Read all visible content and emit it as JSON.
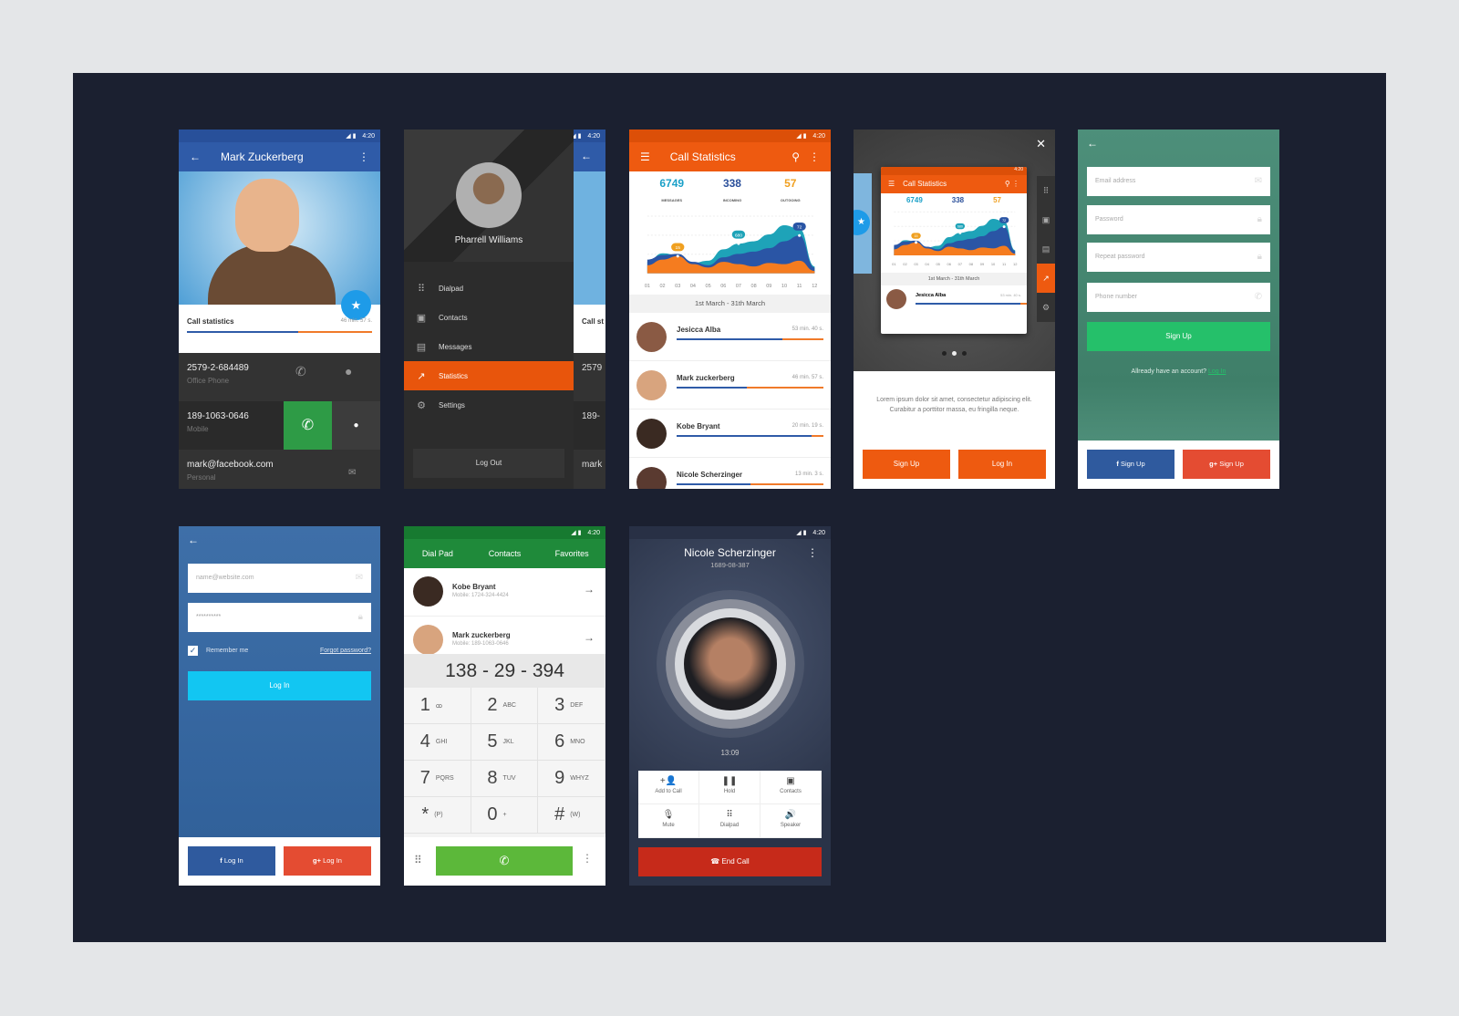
{
  "status_bar": {
    "time": "4:20"
  },
  "colors": {
    "panel": "#1b2030",
    "blue": "#2f5ba8",
    "orange": "#ee5a10",
    "green": "#2e9b46",
    "teal_signup": "#4d8f7a",
    "facebook": "#2f5a9e",
    "google": "#e44c32",
    "end_call": "#c62a1a"
  },
  "profile": {
    "title": "Mark Zuckerberg",
    "card_label": "Call statistics",
    "card_duration": "46 min. 57 s.",
    "progress": 0.6,
    "rows": [
      {
        "value": "2579-2-684489",
        "label": "Office Phone"
      },
      {
        "value": "189-1063-0646",
        "label": "Mobile"
      },
      {
        "value": "mark@facebook.com",
        "label": "Personal"
      }
    ]
  },
  "drawer": {
    "name": "Pharrell Williams",
    "items": [
      {
        "label": "Dialpad",
        "icon": "dialpad-icon"
      },
      {
        "label": "Contacts",
        "icon": "contacts-icon"
      },
      {
        "label": "Messages",
        "icon": "message-icon"
      },
      {
        "label": "Statistics",
        "icon": "trending-icon",
        "active": true
      },
      {
        "label": "Settings",
        "icon": "gear-icon"
      }
    ],
    "logout": "Log Out",
    "peek": {
      "row1": "2579",
      "row2": "189-",
      "row3": "mark",
      "card": "Call st"
    }
  },
  "stats": {
    "title": "Call Statistics",
    "summary": [
      {
        "value": "6749",
        "label": "MESSAGES",
        "color": "#1aa0c8"
      },
      {
        "value": "338",
        "label": "INCOMING",
        "color": "#2a4f9a"
      },
      {
        "value": "57",
        "label": "OUTGOING",
        "color": "#f0a020"
      }
    ],
    "date_range": "1st March - 31th March",
    "list": [
      {
        "name": "Jesicca Alba",
        "duration": "53 min. 40 s.",
        "progress": 0.72
      },
      {
        "name": "Mark zuckerberg",
        "duration": "46 min. 57 s.",
        "progress": 0.48
      },
      {
        "name": "Kobe Bryant",
        "duration": "20 min. 19 s.",
        "progress": 0.92
      },
      {
        "name": "Nicole Scherzinger",
        "duration": "13 min. 3 s.",
        "progress": 0.5
      }
    ]
  },
  "chart_data": {
    "type": "area",
    "categories": [
      "01",
      "02",
      "03",
      "04",
      "05",
      "06",
      "07",
      "08",
      "09",
      "10",
      "11",
      "12"
    ],
    "series": [
      {
        "color": "#1ea3b8",
        "values": [
          20,
          35,
          32,
          18,
          22,
          42,
          52,
          56,
          68,
          84,
          78,
          12
        ]
      },
      {
        "color": "#2a55a5",
        "values": [
          24,
          32,
          34,
          20,
          14,
          28,
          34,
          38,
          44,
          56,
          66,
          10
        ]
      },
      {
        "color": "#f57c1f",
        "values": [
          14,
          24,
          30,
          16,
          10,
          20,
          16,
          12,
          18,
          16,
          22,
          4
        ]
      }
    ],
    "annotations": [
      {
        "x": "03",
        "label": "15",
        "color": "#f0a020"
      },
      {
        "x": "07",
        "label": "680",
        "color": "#1ea3b8"
      },
      {
        "x": "11",
        "label": "72",
        "color": "#2a55a5"
      }
    ],
    "grid": true
  },
  "onboarding": {
    "text": "Lorem ipsum dolor sit amet, consectetur adipiscing elit. Curabitur a porttitor massa, eu fringilla neque.",
    "signup": "Sign Up",
    "login": "Log In",
    "page_index": 1,
    "pages": 3,
    "mini_item": {
      "name": "Jesicca Alba",
      "duration": "53 min. 40 s."
    }
  },
  "signup": {
    "email_ph": "Email address",
    "password_ph": "Password",
    "repeat_ph": "Repeat password",
    "phone_ph": "Phone number",
    "button": "Sign Up",
    "already": "Allready have an account?",
    "login_link": "Log In",
    "fb": "Sign Up",
    "google": "Sign Up"
  },
  "login": {
    "email_ph": "name@website.com",
    "password_value": "**********",
    "remember": "Remember me",
    "remember_checked": true,
    "forgot": "Forgot password?",
    "button": "Log In",
    "fb": "Log In",
    "google": "Log In"
  },
  "dialpad": {
    "tabs": [
      "Dial Pad",
      "Contacts",
      "Favorites"
    ],
    "contacts": [
      {
        "name": "Kobe Bryant",
        "mobile": "Mobile: 1724-324-4424"
      },
      {
        "name": "Mark zuckerberg",
        "mobile": "Mobile: 189-1063-0646"
      }
    ],
    "number": "138 - 29 - 394",
    "keys": [
      {
        "d": "1",
        "l": "ꝏ"
      },
      {
        "d": "2",
        "l": "ABC"
      },
      {
        "d": "3",
        "l": "DEF"
      },
      {
        "d": "4",
        "l": "GHI"
      },
      {
        "d": "5",
        "l": "JKL"
      },
      {
        "d": "6",
        "l": "MNO"
      },
      {
        "d": "7",
        "l": "PQRS"
      },
      {
        "d": "8",
        "l": "TUV"
      },
      {
        "d": "9",
        "l": "WHYZ"
      },
      {
        "d": "*",
        "l": "(P)"
      },
      {
        "d": "0",
        "l": "+"
      },
      {
        "d": "#",
        "l": "(W)"
      }
    ]
  },
  "call": {
    "name": "Nicole Scherzinger",
    "number": "1689-08-387",
    "timer": "13:09",
    "actions": [
      {
        "label": "Add to Call",
        "icon": "add-person-icon",
        "g": "+👤"
      },
      {
        "label": "Hold",
        "icon": "pause-icon",
        "g": "❚❚"
      },
      {
        "label": "Contacts",
        "icon": "contacts-icon",
        "g": "▣"
      },
      {
        "label": "Mute",
        "icon": "mic-off-icon",
        "g": "🎙"
      },
      {
        "label": "Dialpad",
        "icon": "dialpad-icon",
        "g": "⠿"
      },
      {
        "label": "Speaker",
        "icon": "speaker-icon",
        "g": "🔊"
      }
    ],
    "end": "End Call"
  }
}
